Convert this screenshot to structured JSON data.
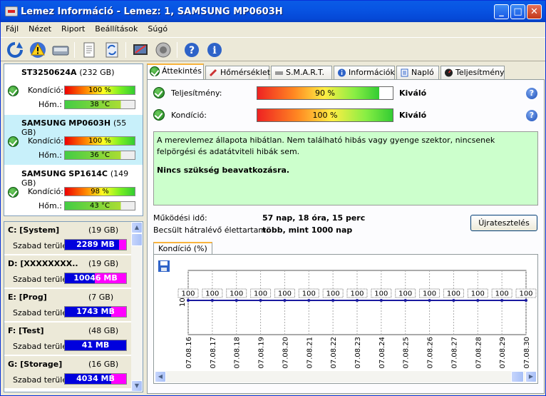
{
  "window": {
    "title": "Lemez Információ - Lemez: 1, SAMSUNG MP0603H"
  },
  "menu": [
    "Fájl",
    "Nézet",
    "Riport",
    "Beállítások",
    "Súgó"
  ],
  "toolbar_icons": [
    "refresh-icon",
    "warning-icon",
    "disk-icon",
    "report-icon",
    "update-icon",
    "benchmark-icon",
    "sound-icon",
    "help-icon",
    "info-icon"
  ],
  "disks": [
    {
      "name": "ST3250624A",
      "size": "(232 GB)",
      "condition_label": "Kondíció:",
      "condition": "100 %",
      "condition_value": 100,
      "temp_label": "Hőm.:",
      "temp": "38 °C",
      "temp_value": 38
    },
    {
      "name": "SAMSUNG MP0603H",
      "size": "(55 GB)",
      "condition_label": "Kondíció:",
      "condition": "100 %",
      "condition_value": 100,
      "temp_label": "Hőm.:",
      "temp": "36 °C",
      "temp_value": 36
    },
    {
      "name": "SAMSUNG SP1614C",
      "size": "(149 GB)",
      "condition_label": "Kondíció:",
      "condition": "98 %",
      "condition_value": 98,
      "temp_label": "Hőm.:",
      "temp": "43 °C",
      "temp_value": 43
    }
  ],
  "partitions": [
    {
      "name": "C: [System]",
      "size": "(19 GB)",
      "free_label": "Szabad terület",
      "free": "2289 MB",
      "used_fraction": 0.88
    },
    {
      "name": "D: [XXXXXXXX..",
      "size": "(19 GB)",
      "free_label": "Szabad terület",
      "free": "10046 MB",
      "used_fraction": 0.49
    },
    {
      "name": "E: [Prog]",
      "size": "(7 GB)",
      "free_label": "Szabad terület",
      "free": "1743 MB",
      "used_fraction": 0.76
    },
    {
      "name": "F: [Test]",
      "size": "(48 GB)",
      "free_label": "Szabad terület",
      "free": "41 MB",
      "used_fraction": 1.0
    },
    {
      "name": "G: [Storage]",
      "size": "(16 GB)",
      "free_label": "Szabad terület",
      "free": "4034 MB",
      "used_fraction": 0.75
    }
  ],
  "tabs": [
    "Áttekintés",
    "Hőmérséklet",
    "S.M.A.R.T.",
    "Információk",
    "Napló",
    "Teljesítmény"
  ],
  "overview": {
    "performance_label": "Teljesítmény:",
    "performance": "90 %",
    "performance_value": 90,
    "performance_rating": "Kiváló",
    "condition_label": "Kondíció:",
    "condition": "100 %",
    "condition_value": 100,
    "condition_rating": "Kiváló",
    "message": "A merevlemez állapota hibátlan. Nem található hibás vagy gyenge szektor, nincsenek felpörgési és adatátviteli hibák sem.",
    "recommendation": "Nincs szükség beavatkozásra.",
    "uptime_label": "Működési idő:",
    "uptime": "57 nap, 18 óra, 15 perc",
    "remaining_label": "Becsült hátralévő élettartam:",
    "remaining": "több, mint 1000 nap",
    "retest_button": "Újratesztelés",
    "chart_tab": "Kondíció (%)"
  },
  "chart_data": {
    "type": "line",
    "x": [
      "07.08.16",
      "07.08.17",
      "07.08.18",
      "07.08.19",
      "07.08.20",
      "07.08.21",
      "07.08.22",
      "07.08.23",
      "07.08.24",
      "07.08.25",
      "07.08.26",
      "07.08.27",
      "07.08.28",
      "07.08.29",
      "07.08.30"
    ],
    "series": [
      {
        "values": [
          100,
          100,
          100,
          100,
          100,
          100,
          100,
          100,
          100,
          100,
          100,
          100,
          100,
          100,
          100
        ]
      }
    ],
    "y_tick": "100",
    "ylim": [
      0,
      100
    ],
    "grid": true,
    "color": "#1a1aa0"
  }
}
